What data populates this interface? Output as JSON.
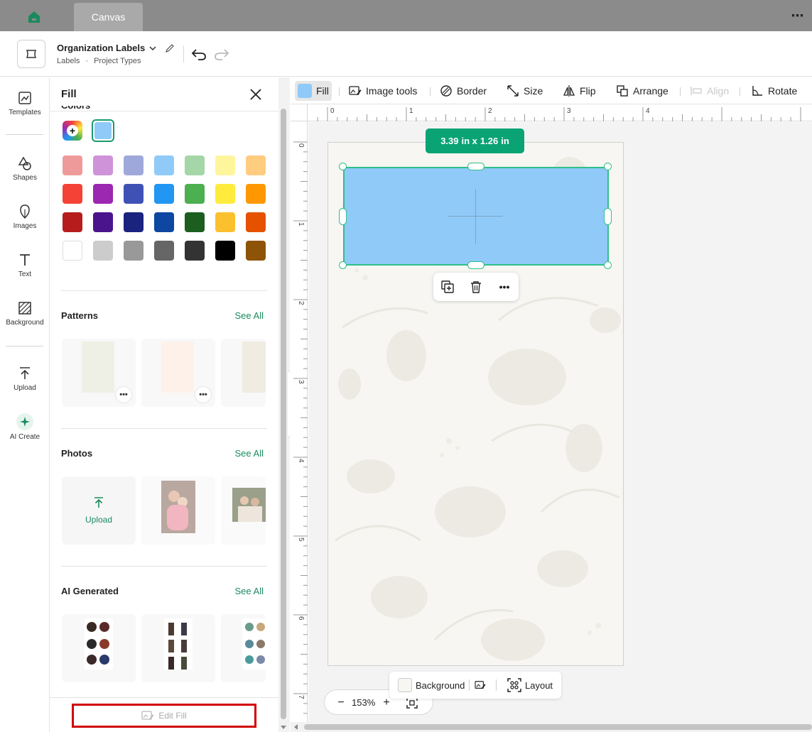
{
  "tabs": {
    "active_label": "Canvas"
  },
  "header": {
    "project_title": "Organization Labels",
    "breadcrumb": [
      "Labels",
      "·",
      "Project Types"
    ]
  },
  "rail": {
    "items": [
      {
        "label": "Templates",
        "icon": "templates-icon"
      },
      {
        "label": "Shapes",
        "icon": "shapes-icon"
      },
      {
        "label": "Images",
        "icon": "images-icon"
      },
      {
        "label": "Text",
        "icon": "text-icon"
      },
      {
        "label": "Background",
        "icon": "background-icon"
      },
      {
        "label": "Upload",
        "icon": "upload-icon"
      },
      {
        "label": "AI Create",
        "icon": "sparkle-icon"
      }
    ]
  },
  "panel": {
    "title": "Fill",
    "colors_label": "Colors",
    "selected_color": "#90caf9",
    "palette": [
      [
        "#ef9a9a",
        "#ce93d8",
        "#9fa8da",
        "#90caf9",
        "#a5d6a7",
        "#fff59d",
        "#ffcc80"
      ],
      [
        "#f44336",
        "#9c27b0",
        "#3f51b5",
        "#2196f3",
        "#4caf50",
        "#ffeb3b",
        "#ff9800"
      ],
      [
        "#b71c1c",
        "#4a148c",
        "#1a237e",
        "#0d47a1",
        "#1b5e20",
        "#fbc02d",
        "#e65100"
      ],
      [
        "#ffffff",
        "#cccccc",
        "#999999",
        "#666666",
        "#333333",
        "#000000",
        "#8d5306"
      ]
    ],
    "sections": {
      "patterns": {
        "title": "Patterns",
        "see_all": "See All"
      },
      "photos": {
        "title": "Photos",
        "see_all": "See All",
        "upload_label": "Upload"
      },
      "ai": {
        "title": "AI Generated",
        "see_all": "See All"
      }
    },
    "edit_fill": "Edit Fill"
  },
  "toolbar": {
    "fill": "Fill",
    "image_tools": "Image tools",
    "border": "Border",
    "size": "Size",
    "flip": "Flip",
    "arrange": "Arrange",
    "align": "Align",
    "rotate": "Rotate"
  },
  "rulers": {
    "top": [
      "0",
      "1",
      "2",
      "3",
      "4"
    ],
    "left": [
      "0",
      "1",
      "2",
      "3",
      "4",
      "5",
      "6",
      "7"
    ]
  },
  "selection": {
    "size_w": "3.39",
    "size_sep": "in x",
    "size_h": "1.26",
    "size_unit": "in"
  },
  "zoom": {
    "value": "153%",
    "minus": "−",
    "plus": "+"
  },
  "bottom_bar": {
    "background": "Background",
    "layout": "Layout"
  },
  "colors": {
    "accent": "#1a8a5e",
    "selection": "#2fbf8a",
    "badge": "#0aa374",
    "highlight_box": "#d10000"
  }
}
